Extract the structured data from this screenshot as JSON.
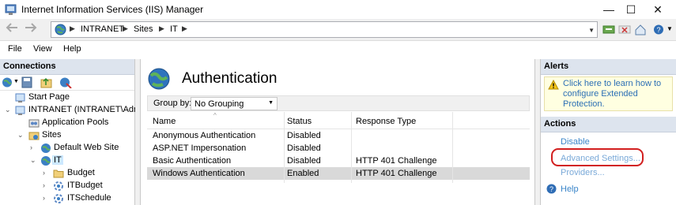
{
  "window": {
    "title": "Internet Information Services (IIS) Manager",
    "min_glyph": "—",
    "max_glyph": "☐",
    "close_glyph": "✕"
  },
  "address": {
    "crumbs": [
      "INTRANET",
      "Sites",
      "IT"
    ],
    "separator": "▶"
  },
  "menu": {
    "items": [
      "File",
      "View",
      "Help"
    ]
  },
  "connections": {
    "header": "Connections",
    "tree": [
      {
        "label": "Start Page",
        "icon": "start-page-icon",
        "expand": ""
      },
      {
        "label": "INTRANET (INTRANET\\Admi",
        "icon": "server-icon",
        "expand": "⌄"
      },
      {
        "label": "Application Pools",
        "icon": "app-pools-icon",
        "expand": ""
      },
      {
        "label": "Sites",
        "icon": "sites-folder-icon",
        "expand": "⌄"
      },
      {
        "label": "Default Web Site",
        "icon": "globe-icon",
        "expand": "›"
      },
      {
        "label": "IT",
        "icon": "globe-icon",
        "expand": "⌄"
      },
      {
        "label": "Budget",
        "icon": "folder-icon",
        "expand": "›"
      },
      {
        "label": "ITBudget",
        "icon": "application-icon",
        "expand": "›"
      },
      {
        "label": "ITSchedule",
        "icon": "application-icon",
        "expand": "›"
      }
    ]
  },
  "main": {
    "title": "Authentication",
    "group_by_label": "Group by:",
    "group_by_value": "No Grouping",
    "columns": [
      "Name",
      "Status",
      "Response Type"
    ],
    "rows": [
      {
        "name": "Anonymous Authentication",
        "status": "Disabled",
        "response": ""
      },
      {
        "name": "ASP.NET Impersonation",
        "status": "Disabled",
        "response": ""
      },
      {
        "name": "Basic Authentication",
        "status": "Disabled",
        "response": "HTTP 401 Challenge"
      },
      {
        "name": "Windows Authentication",
        "status": "Enabled",
        "response": "HTTP 401 Challenge"
      }
    ]
  },
  "alerts": {
    "header": "Alerts",
    "message": "Click here to learn how to configure Extended Protection."
  },
  "actions": {
    "header": "Actions",
    "items": [
      "Disable",
      "Advanced Settings...",
      "Providers...",
      "Help"
    ]
  },
  "colors": {
    "link": "#3a85c9",
    "highlight_ring": "#d21f1f",
    "panel_header": "#dde4ee"
  }
}
